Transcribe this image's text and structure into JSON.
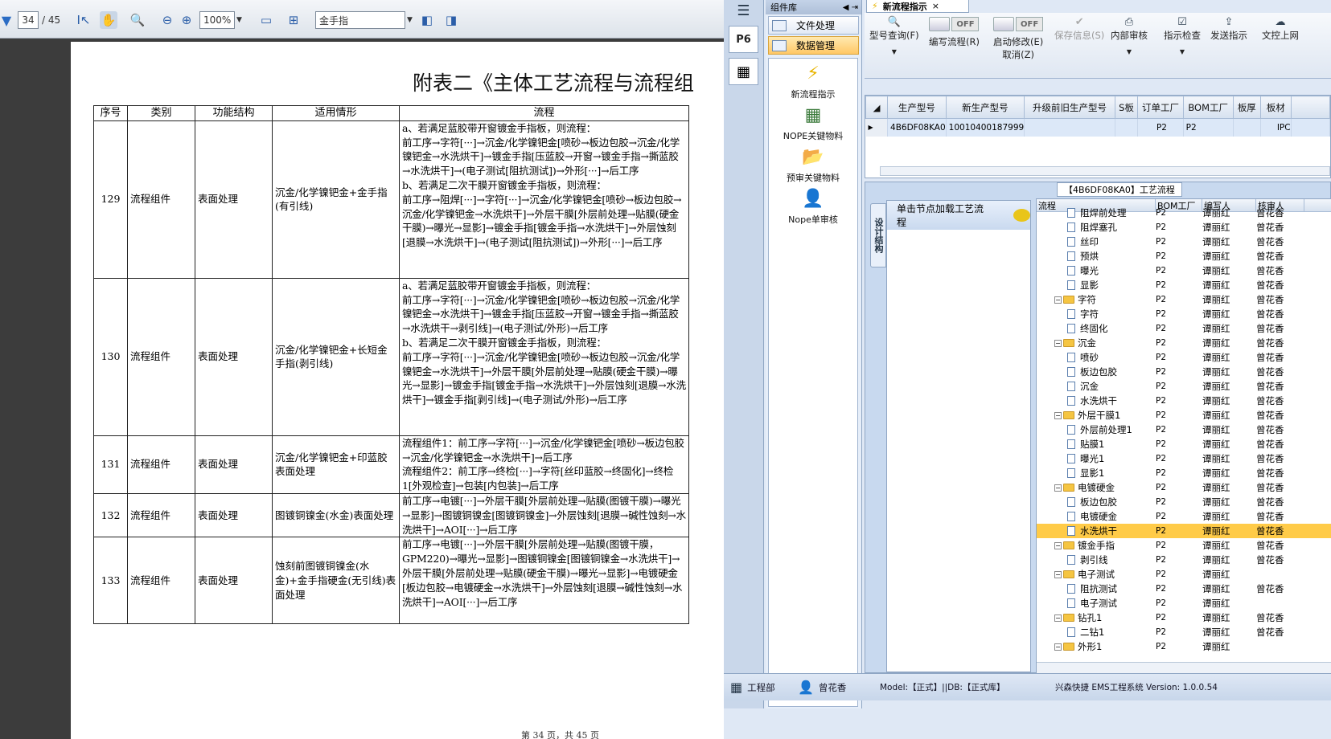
{
  "pdf_toolbar": {
    "page_current": "34",
    "page_total": "/ 45",
    "zoom": "100%",
    "search_value": "金手指"
  },
  "document": {
    "title": "附表二《主体工艺流程与流程组",
    "headers": [
      "序号",
      "类别",
      "功能结构",
      "适用情形",
      "流程"
    ],
    "rows": [
      {
        "no": "129",
        "category": "流程组件",
        "function": "表面处理",
        "case": "沉金/化学镍钯金+金手指(有引线)",
        "flow": "a、若满足蓝胶带开窗镀金手指板，则流程：\n前工序→字符[···]→沉金/化学镍钯金[喷砂→板边包胶→沉金/化学镍钯金→水洗烘干]→镀金手指[压蓝胶→开窗→镀金手指→撕蓝胶→水洗烘干]→(电子测试[阻抗测试])→外形[···]→后工序\nb、若满足二次干膜开窗镀金手指板，则流程：\n前工序→阻焊[···]→字符[···]→沉金/化学镍钯金[喷砂→板边包胶→沉金/化学镍钯金→水洗烘干]→外层干膜[外层前处理→贴膜(硬金干膜)→曝光→显影]→镀金手指[镀金手指→水洗烘干]→外层蚀刻[退膜→水洗烘干]→(电子测试[阻抗测试])→外形[···]→后工序"
      },
      {
        "no": "130",
        "category": "流程组件",
        "function": "表面处理",
        "case": "沉金/化学镍钯金+长短金手指(剥引线)",
        "flow": "a、若满足蓝胶带开窗镀金手指板，则流程：\n前工序→字符[···]→沉金/化学镍钯金[喷砂→板边包胶→沉金/化学镍钯金→水洗烘干]→镀金手指[压蓝胶→开窗→镀金手指→撕蓝胶→水洗烘干→剥引线]→(电子测试/外形)→后工序\nb、若满足二次干膜开窗镀金手指板，则流程：\n前工序→字符[···]→沉金/化学镍钯金[喷砂→板边包胶→沉金/化学镍钯金→水洗烘干]→外层干膜[外层前处理→贴膜(硬金干膜)→曝光→显影]→镀金手指[镀金手指→水洗烘干]→外层蚀刻[退膜→水洗烘干]→镀金手指[剥引线]→(电子测试/外形)→后工序"
      },
      {
        "no": "131",
        "category": "流程组件",
        "function": "表面处理",
        "case": "沉金/化学镍钯金+印蓝胶表面处理",
        "flow": "流程组件1：前工序→字符[···]→沉金/化学镍钯金[喷砂→板边包胶→沉金/化学镍钯金→水洗烘干]→后工序\n流程组件2：前工序→终检[···]→字符[丝印蓝胶→终固化]→终检1[外观检查]→包装[内包装]→后工序"
      },
      {
        "no": "132",
        "category": "流程组件",
        "function": "表面处理",
        "case": "图镀铜镍金(水金)表面处理",
        "flow": "前工序→电镀[···]→外层干膜[外层前处理→贴膜(图镀干膜)→曝光→显影]→图镀铜镍金[图镀铜镍金]→外层蚀刻[退膜→碱性蚀刻→水洗烘干]→AOI[···]→后工序"
      },
      {
        "no": "133",
        "category": "流程组件",
        "function": "表面处理",
        "case": "蚀刻前图镀铜镍金(水金)+金手指硬金(无引线)表面处理",
        "flow": "前工序→电镀[···]→外层干膜[外层前处理→贴膜(图镀干膜，GPM220)→曝光→显影]→图镀铜镍金[图镀铜镍金→水洗烘干]→外层干膜[外层前处理→贴膜(硬金干膜)→曝光→显影]→电镀硬金[板边包胶→电镀硬金→水洗烘干]→外层蚀刻[退膜→碱性蚀刻→水洗烘干]→AOI[···]→后工序"
      }
    ],
    "footer": "第 34 页，共 45 页"
  },
  "app": {
    "lib_title": "组件库",
    "lib_buttons": [
      "文件处理",
      "数据管理"
    ],
    "lib_items": [
      "新流程指示",
      "NOPE关键物料",
      "预审关键物料",
      "Nope单审核"
    ],
    "tab_label": "新流程指示",
    "ribbon": [
      {
        "label": "型号查询(F)",
        "icon": "search-icon"
      },
      {
        "label": "编写流程(R)",
        "toggle": "OFF"
      },
      {
        "label": "启动修改(E)",
        "sub": "取消(Z)",
        "toggle": "OFF"
      },
      {
        "label": "保存信息(S)",
        "icon": "check-icon",
        "disabled": true
      },
      {
        "label": "内部审核",
        "icon": "printer-icon"
      },
      {
        "label": "指示检查",
        "icon": "checklist-icon"
      },
      {
        "label": "发送指示",
        "icon": "upload-icon"
      },
      {
        "label": "文控上网",
        "icon": "cloud-upload-icon"
      }
    ],
    "grid_headers": [
      "生产型号",
      "新生产型号",
      "升级前旧生产型号",
      "S板",
      "订单工厂",
      "BOM工厂",
      "板厚",
      "板材"
    ],
    "grid_row": [
      "4B6DF08KA0",
      "10010400187999",
      "",
      "",
      "P2",
      "P2",
      "",
      "IPC"
    ],
    "flow_title": "【4B6DF08KA0】工艺流程",
    "side_tab": "设计结构",
    "side_head": "单击节点加载工艺流程",
    "tree_headers": [
      "流程",
      "BOM工厂",
      "编写人",
      "核审人"
    ],
    "tree_rows": [
      {
        "level": 1,
        "type": "doc",
        "name": "阻焊前处理",
        "bom": "P2",
        "writer": "谭丽红",
        "reviewer": "曾花香"
      },
      {
        "level": 1,
        "type": "doc",
        "name": "阻焊塞孔",
        "bom": "P2",
        "writer": "谭丽红",
        "reviewer": "曾花香"
      },
      {
        "level": 1,
        "type": "doc",
        "name": "丝印",
        "bom": "P2",
        "writer": "谭丽红",
        "reviewer": "曾花香"
      },
      {
        "level": 1,
        "type": "doc",
        "name": "预烘",
        "bom": "P2",
        "writer": "谭丽红",
        "reviewer": "曾花香"
      },
      {
        "level": 1,
        "type": "doc",
        "name": "曝光",
        "bom": "P2",
        "writer": "谭丽红",
        "reviewer": "曾花香"
      },
      {
        "level": 1,
        "type": "doc",
        "name": "显影",
        "bom": "P2",
        "writer": "谭丽红",
        "reviewer": "曾花香"
      },
      {
        "level": 0,
        "type": "folder",
        "name": "字符",
        "bom": "P2",
        "writer": "谭丽红",
        "reviewer": "曾花香"
      },
      {
        "level": 1,
        "type": "doc",
        "name": "字符",
        "bom": "P2",
        "writer": "谭丽红",
        "reviewer": "曾花香"
      },
      {
        "level": 1,
        "type": "doc",
        "name": "终固化",
        "bom": "P2",
        "writer": "谭丽红",
        "reviewer": "曾花香"
      },
      {
        "level": 0,
        "type": "folder",
        "name": "沉金",
        "bom": "P2",
        "writer": "谭丽红",
        "reviewer": "曾花香"
      },
      {
        "level": 1,
        "type": "doc",
        "name": "喷砂",
        "bom": "P2",
        "writer": "谭丽红",
        "reviewer": "曾花香"
      },
      {
        "level": 1,
        "type": "doc",
        "name": "板边包胶",
        "bom": "P2",
        "writer": "谭丽红",
        "reviewer": "曾花香"
      },
      {
        "level": 1,
        "type": "doc",
        "name": "沉金",
        "bom": "P2",
        "writer": "谭丽红",
        "reviewer": "曾花香"
      },
      {
        "level": 1,
        "type": "doc",
        "name": "水洗烘干",
        "bom": "P2",
        "writer": "谭丽红",
        "reviewer": "曾花香"
      },
      {
        "level": 0,
        "type": "folder",
        "name": "外层干膜1",
        "bom": "P2",
        "writer": "谭丽红",
        "reviewer": "曾花香"
      },
      {
        "level": 1,
        "type": "doc",
        "name": "外层前处理1",
        "bom": "P2",
        "writer": "谭丽红",
        "reviewer": "曾花香"
      },
      {
        "level": 1,
        "type": "doc",
        "name": "贴膜1",
        "bom": "P2",
        "writer": "谭丽红",
        "reviewer": "曾花香"
      },
      {
        "level": 1,
        "type": "doc",
        "name": "曝光1",
        "bom": "P2",
        "writer": "谭丽红",
        "reviewer": "曾花香"
      },
      {
        "level": 1,
        "type": "doc",
        "name": "显影1",
        "bom": "P2",
        "writer": "谭丽红",
        "reviewer": "曾花香"
      },
      {
        "level": 0,
        "type": "folder",
        "name": "电镀硬金",
        "bom": "P2",
        "writer": "谭丽红",
        "reviewer": "曾花香"
      },
      {
        "level": 1,
        "type": "doc",
        "name": "板边包胶",
        "bom": "P2",
        "writer": "谭丽红",
        "reviewer": "曾花香"
      },
      {
        "level": 1,
        "type": "doc",
        "name": "电镀硬金",
        "bom": "P2",
        "writer": "谭丽红",
        "reviewer": "曾花香"
      },
      {
        "level": 1,
        "type": "doc",
        "name": "水洗烘干",
        "bom": "P2",
        "writer": "谭丽红",
        "reviewer": "曾花香",
        "selected": true
      },
      {
        "level": 0,
        "type": "folder",
        "name": "镀金手指",
        "bom": "P2",
        "writer": "谭丽红",
        "reviewer": "曾花香"
      },
      {
        "level": 1,
        "type": "doc",
        "name": "剥引线",
        "bom": "P2",
        "writer": "谭丽红",
        "reviewer": "曾花香"
      },
      {
        "level": 0,
        "type": "folder",
        "name": "电子测试",
        "bom": "P2",
        "writer": "谭丽红",
        "reviewer": ""
      },
      {
        "level": 1,
        "type": "doc",
        "name": "阻抗测试",
        "bom": "P2",
        "writer": "谭丽红",
        "reviewer": "曾花香"
      },
      {
        "level": 1,
        "type": "doc",
        "name": "电子测试",
        "bom": "P2",
        "writer": "谭丽红",
        "reviewer": ""
      },
      {
        "level": 0,
        "type": "folder",
        "name": "钻孔1",
        "bom": "P2",
        "writer": "谭丽红",
        "reviewer": "曾花香"
      },
      {
        "level": 1,
        "type": "doc",
        "name": "二钻1",
        "bom": "P2",
        "writer": "谭丽红",
        "reviewer": "曾花香"
      },
      {
        "level": 0,
        "type": "folder",
        "name": "外形1",
        "bom": "P2",
        "writer": "谭丽红",
        "reviewer": ""
      }
    ],
    "status": {
      "dept": "工程部",
      "user": "曾花香",
      "env": "Model:【正式】||DB:【正式库】",
      "brand": "兴森快捷 EMS工程系统 Version: 1.0.0.54"
    }
  },
  "colors": {
    "accent": "#ffcb48",
    "app_bg": "#dfe8f5",
    "grid_sel": "#dce8f8"
  }
}
